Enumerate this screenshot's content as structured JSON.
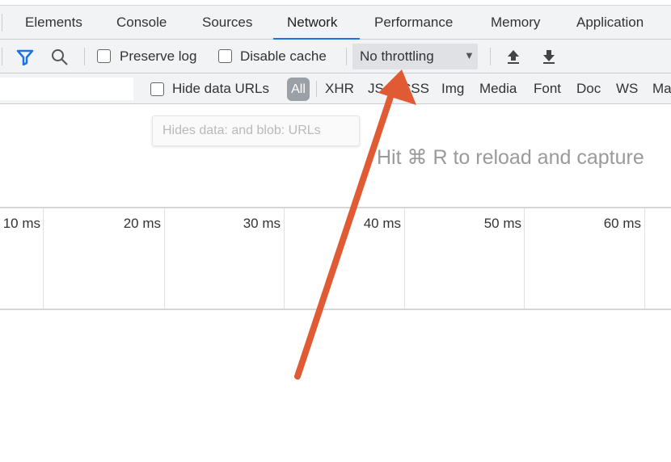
{
  "tabs": [
    {
      "label": "Elements"
    },
    {
      "label": "Console"
    },
    {
      "label": "Sources"
    },
    {
      "label": "Network",
      "active": true
    },
    {
      "label": "Performance"
    },
    {
      "label": "Memory"
    },
    {
      "label": "Application"
    }
  ],
  "toolbar": {
    "preserve_log": "Preserve log",
    "disable_cache": "Disable cache",
    "throttling": "No throttling",
    "filter_icon": "filter-icon",
    "search_icon": "search-icon",
    "upload_icon": "upload-har-icon",
    "download_icon": "download-har-icon"
  },
  "filters": {
    "input_value": "",
    "hide_data_urls": "Hide data URLs",
    "types": [
      "All",
      "XHR",
      "JS",
      "CSS",
      "Img",
      "Media",
      "Font",
      "Doc",
      "WS",
      "Manifest"
    ]
  },
  "tooltip": "Hides data: and blob: URLs",
  "hint": "Hit ⌘ R to reload and capture",
  "timeline": {
    "ticks": [
      "10 ms",
      "20 ms",
      "30 ms",
      "40 ms",
      "50 ms",
      "60 ms"
    ]
  },
  "colors": {
    "accent": "#1a73e8",
    "annotation_arrow": "#e05a33"
  }
}
